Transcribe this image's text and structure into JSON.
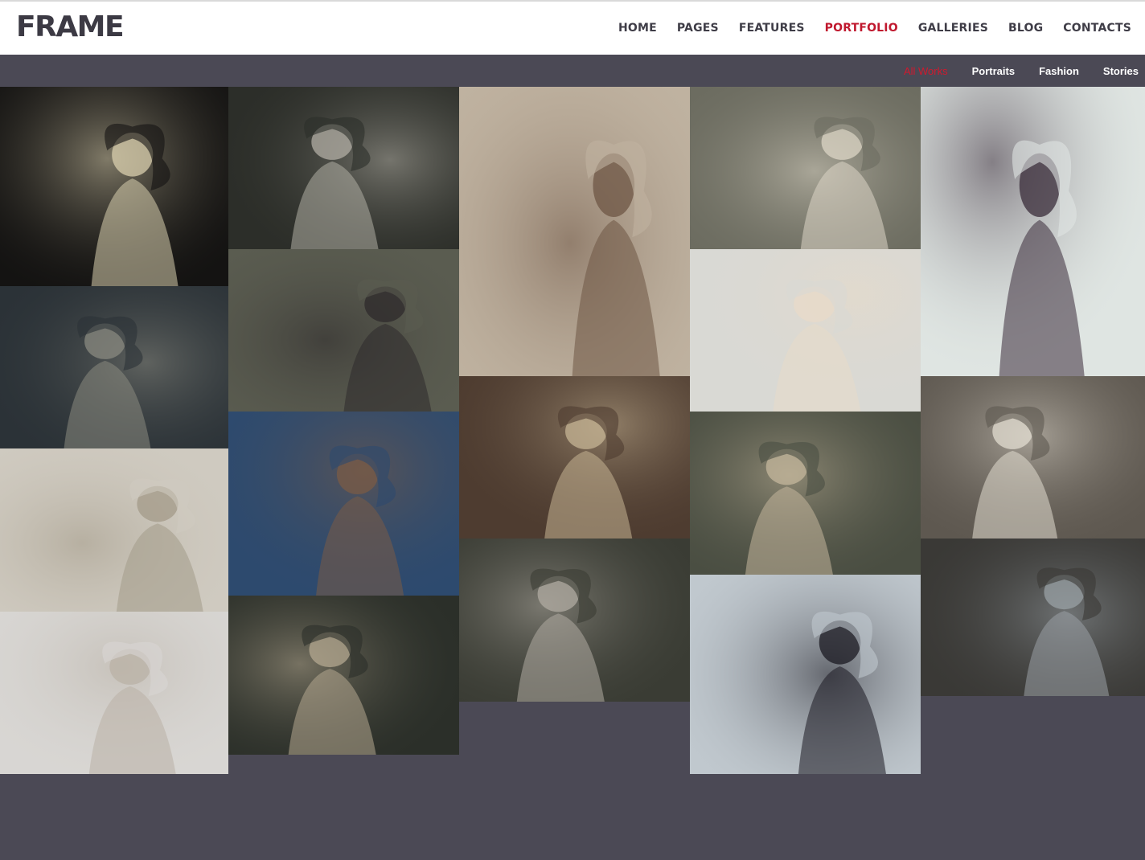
{
  "brand": {
    "logo": "FRAME"
  },
  "nav": {
    "items": [
      {
        "label": "HOME",
        "active": false
      },
      {
        "label": "PAGES",
        "active": false
      },
      {
        "label": "FEATURES",
        "active": false
      },
      {
        "label": "PORTFOLIO",
        "active": true
      },
      {
        "label": "GALLERIES",
        "active": false
      },
      {
        "label": "BLOG",
        "active": false
      },
      {
        "label": "CONTACTS",
        "active": false
      }
    ]
  },
  "filters": {
    "items": [
      {
        "label": "All Works",
        "active": true
      },
      {
        "label": "Portraits",
        "active": false
      },
      {
        "label": "Fashion",
        "active": false
      },
      {
        "label": "Stories",
        "active": false
      }
    ]
  },
  "colors": {
    "accent": "#c0182e",
    "background": "#4b4955",
    "header": "#ffffff",
    "nav_text": "#3f3d47"
  },
  "portfolio": {
    "columns": [
      [
        {
          "name": "portrait-windblown-blonde",
          "bg": "#141312",
          "fg": "#d9cfae"
        },
        {
          "name": "portrait-dark-table",
          "bg": "#2b3237",
          "fg": "#8a8a80"
        },
        {
          "name": "fashion-paper-dress",
          "bg": "#cfcac0",
          "fg": "#a39a88"
        },
        {
          "name": "portrait-white-curls",
          "bg": "#d8d6d3",
          "fg": "#b9b1a6"
        }
      ],
      [
        {
          "name": "story-antique-shop",
          "bg": "#2c2e29",
          "fg": "#b1aea4"
        },
        {
          "name": "fashion-fur-hat-horse",
          "bg": "#5a5c50",
          "fg": "#2e2a2b"
        },
        {
          "name": "portrait-curly-brunette",
          "bg": "#2d4a6e",
          "fg": "#7a5b45"
        },
        {
          "name": "story-two-women-forest",
          "bg": "#2b2f29",
          "fg": "#b4a890"
        }
      ],
      [
        {
          "name": "fashion-two-women-dresses",
          "bg": "#bfb2a0",
          "fg": "#6e5544"
        },
        {
          "name": "story-perfume-sunlight",
          "bg": "#4e3c30",
          "fg": "#c6b494"
        },
        {
          "name": "story-reeds-water",
          "bg": "#3a3c34",
          "fg": "#b0aba2"
        }
      ],
      [
        {
          "name": "story-fairy-ruins",
          "bg": "#6c6c60",
          "fg": "#dcd6c6"
        },
        {
          "name": "portrait-mirror-lipstick",
          "bg": "#d9d9d4",
          "fg": "#e8dac8"
        },
        {
          "name": "story-ruined-hall",
          "bg": "#4a4e42",
          "fg": "#c4b79c"
        },
        {
          "name": "portrait-black-hair",
          "bg": "#c0c8ce",
          "fg": "#1b1a22"
        }
      ],
      [
        {
          "name": "fashion-avant-garde-hair",
          "bg": "#dfe5e2",
          "fg": "#3a2c3a"
        },
        {
          "name": "portrait-lace-garden",
          "bg": "#5e5850",
          "fg": "#e2dcd0"
        },
        {
          "name": "story-snow-globe",
          "bg": "#3a3936",
          "fg": "#9aa1a6"
        }
      ]
    ]
  }
}
